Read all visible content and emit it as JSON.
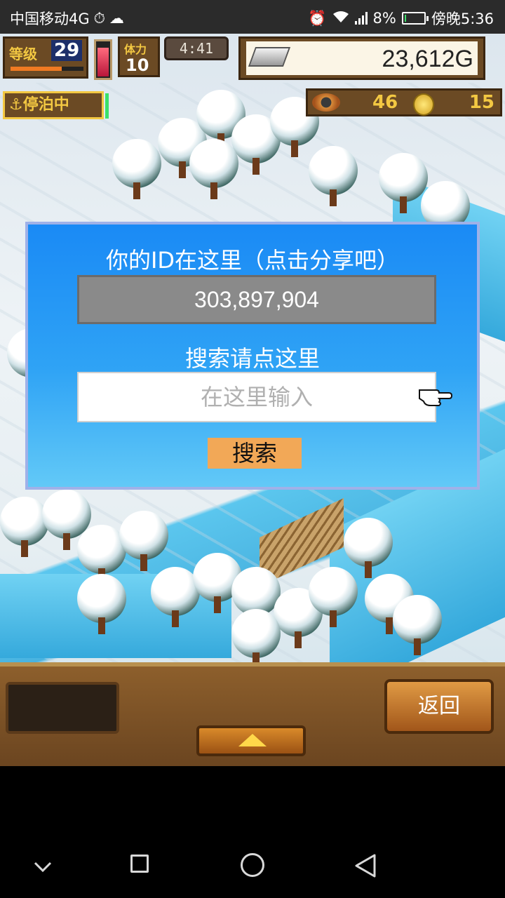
{
  "status_bar": {
    "carrier": "中国移动4G",
    "network": "4G",
    "battery_percent": "8%",
    "battery_level": 0.08,
    "time": "傍晚5:36"
  },
  "hud": {
    "level_label": "等级",
    "level_value": "29",
    "hp_label": "体力",
    "hp_value": "10",
    "timer": "4:41",
    "money": "23,612G",
    "dock_status": "⚓停泊中",
    "item1_count": "46",
    "item2_count": "15",
    "xp_progress": 0.7,
    "stamina_level": 0.85
  },
  "dialog": {
    "title": "你的ID在这里（点击分享吧）",
    "id_value": "303,897,904",
    "search_label": "搜索请点这里",
    "search_placeholder": "在这里输入",
    "search_button": "搜索"
  },
  "bottom": {
    "back_button": "返回"
  },
  "colors": {
    "dialog_blue": "#1a8af5",
    "search_button_bg": "#f2a857",
    "hud_brown": "#6b4a24",
    "hud_gold": "#f3c842"
  },
  "icons": {
    "alarm": "alarm-icon",
    "wifi": "wifi-icon",
    "signal": "signal-icon",
    "battery": "battery-icon",
    "hand": "pointing-hand-icon",
    "anchor": "anchor-icon"
  }
}
